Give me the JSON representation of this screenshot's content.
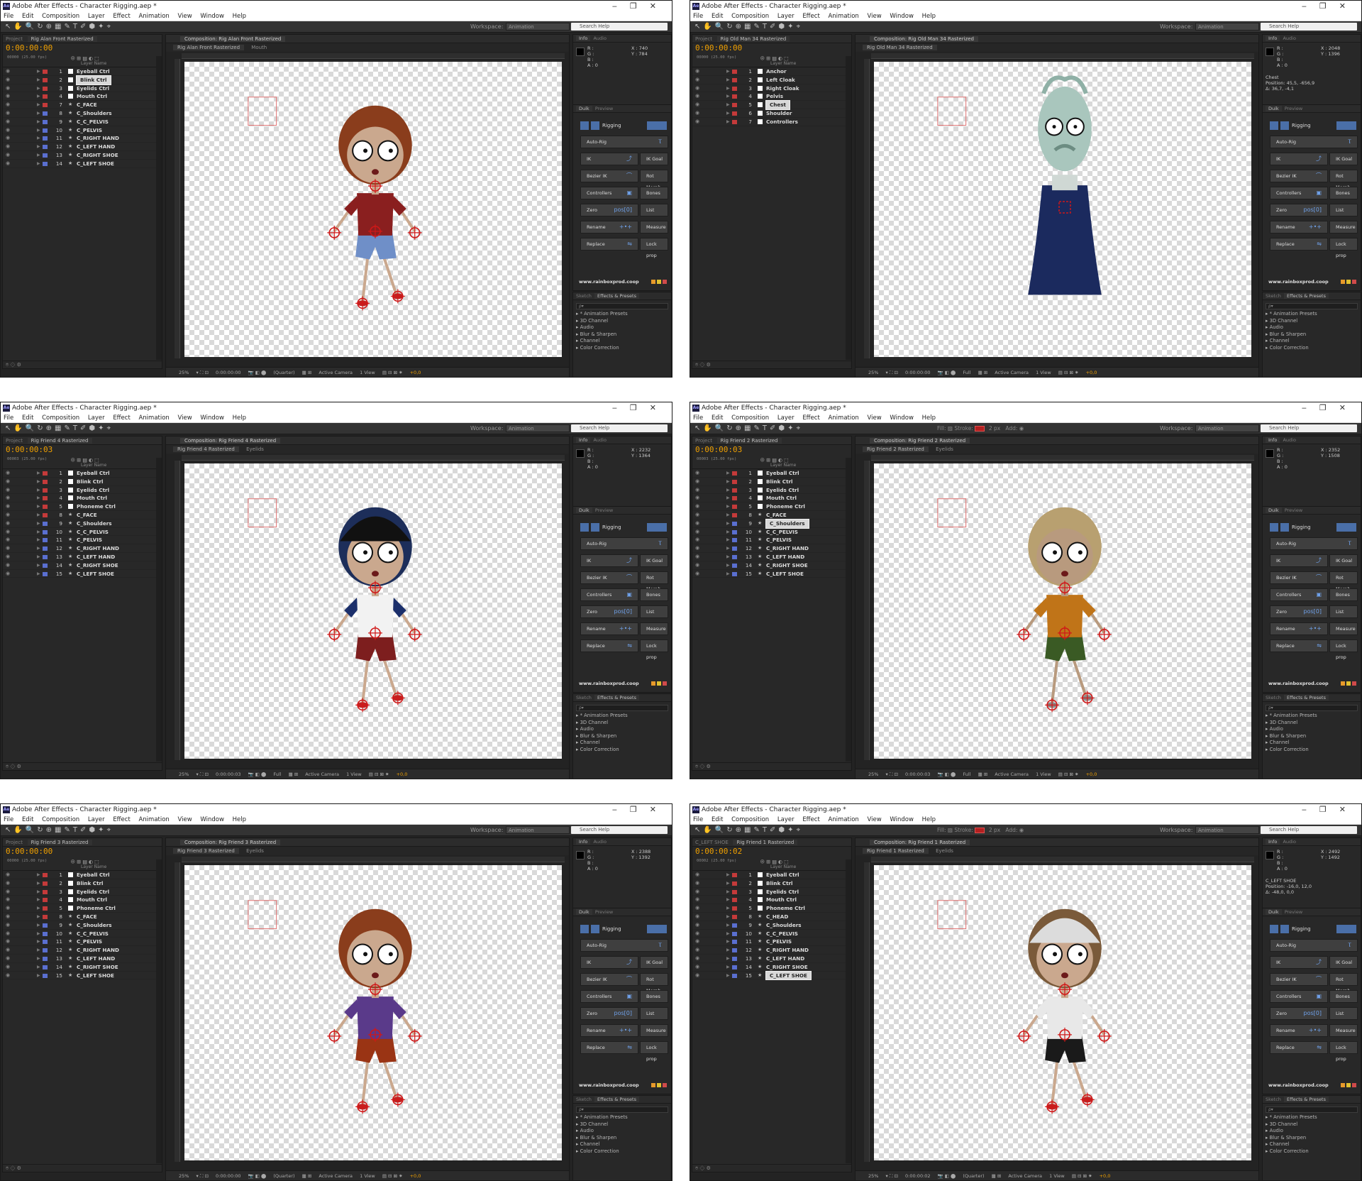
{
  "app": {
    "window_title": "Adobe After Effects - Character Rigging.aep *",
    "logo": "Ae",
    "window_controls": [
      "‒",
      "❐",
      "✕"
    ],
    "menu": [
      "File",
      "Edit",
      "Composition",
      "Layer",
      "Effect",
      "Animation",
      "View",
      "Window",
      "Help"
    ],
    "workspace_label": "Workspace:",
    "workspace_value": "Animation",
    "search_placeholder": "Search Help",
    "fill_label": "Fill:",
    "stroke_label": "Stroke:",
    "stroke_width": "2 px",
    "add_label": "Add:",
    "project_tab": "Project",
    "layer_name_header": "Layer Name",
    "info_tab": "Info",
    "audio_tab": "Audio",
    "duik_tab": "Duik",
    "preview_tab": "Preview",
    "sketch_tab": "Sketch",
    "effects_tab": "Effects & Presets",
    "rgb_lines": [
      "R :",
      "G :",
      "B :",
      "A : 0"
    ],
    "duik": {
      "rigging": "Rigging",
      "buttons": [
        {
          "label": "Auto-Rig",
          "icon": "Ⲧ"
        },
        {
          "label": "IK",
          "icon": "⤴"
        },
        {
          "label": "IK Goal",
          "icon": ""
        },
        {
          "label": "Bezier IK",
          "icon": "⌒"
        },
        {
          "label": "Rot Morph",
          "icon": ""
        },
        {
          "label": "Controllers",
          "icon": "▣"
        },
        {
          "label": "Bones",
          "icon": ""
        },
        {
          "label": "Zero",
          "icon": "pos[0]"
        },
        {
          "label": "List",
          "icon": ""
        },
        {
          "label": "Rename",
          "icon": "+•+"
        },
        {
          "label": "Measure",
          "icon": ""
        },
        {
          "label": "Replace",
          "icon": "⇋"
        },
        {
          "label": "Lock prop",
          "icon": ""
        }
      ],
      "site": "www.rainboxprod.coop",
      "colors": [
        "#e89a2a",
        "#e0c030",
        "#d04a4a"
      ]
    },
    "effects_search": "ρ▾",
    "effects_list": [
      "▸ * Animation Presets",
      "▸ 3D Channel",
      "▸ Audio",
      "▸ Blur & Sharpen",
      "▸ Channel",
      "▸ Color Correction"
    ],
    "footer": {
      "zoom": "25%",
      "camera": "Active Camera",
      "view": "1 View",
      "offset": "+0,0"
    }
  },
  "windows": [
    {
      "comp_tab": "Composition: Rig Alan Front Rasterized",
      "timeline_tab": "Rig Alan Front Rasterized",
      "sub_tab_a": "Rig Alan Front Rasterized",
      "sub_tab_b": "Mouth",
      "timecode": "0:00:00:00",
      "fps": "00000 (25.00 fps)",
      "x": "X : 740",
      "y": "Y : 784",
      "selection": [],
      "show_fill": false,
      "resolution": "(Quarter)",
      "footer_time": "0:00:00:00",
      "layers": [
        {
          "n": "1",
          "name": "Eyeball Ctrl",
          "color": "#c43a3a",
          "kind": "solid",
          "sel": false
        },
        {
          "n": "2",
          "name": "Blink Ctrl",
          "color": "#c43a3a",
          "kind": "solid",
          "sel": true
        },
        {
          "n": "3",
          "name": "Eyelids Ctrl",
          "color": "#c43a3a",
          "kind": "solid",
          "sel": false
        },
        {
          "n": "4",
          "name": "Mouth Ctrl",
          "color": "#c43a3a",
          "kind": "solid",
          "sel": false
        },
        {
          "n": "7",
          "name": "C_FACE",
          "color": "#c43a3a",
          "kind": "shape",
          "sel": false
        },
        {
          "n": "8",
          "name": "C_Shoulders",
          "color": "#5a6fd0",
          "kind": "shape",
          "sel": false
        },
        {
          "n": "9",
          "name": "C_C_PELVIS",
          "color": "#5a6fd0",
          "kind": "shape",
          "sel": false
        },
        {
          "n": "10",
          "name": "C_PELVIS",
          "color": "#5a6fd0",
          "kind": "shape",
          "sel": false
        },
        {
          "n": "11",
          "name": "C_RIGHT HAND",
          "color": "#5a6fd0",
          "kind": "shape",
          "sel": false
        },
        {
          "n": "12",
          "name": "C_LEFT HAND",
          "color": "#5a6fd0",
          "kind": "shape",
          "sel": false
        },
        {
          "n": "13",
          "name": "C_RIGHT SHOE",
          "color": "#5a6fd0",
          "kind": "shape",
          "sel": false
        },
        {
          "n": "14",
          "name": "C_LEFT SHOE",
          "color": "#5a6fd0",
          "kind": "shape",
          "sel": false
        }
      ]
    },
    {
      "comp_tab": "Composition: Rig Old Man 34 Rasterized",
      "timeline_tab": "Rig Old Man 34 Rasterized",
      "sub_tab_a": "Rig Old Man 34 Rasterized",
      "sub_tab_b": "",
      "timecode": "0:00:00:00",
      "fps": "00000 (25.00 fps)",
      "x": "X : 2048",
      "y": "Y : 1396",
      "selection": [
        "Chest",
        "Position: 45,5, -656,9",
        "Δ: 36,7, -4,1"
      ],
      "show_fill": false,
      "resolution": "Full",
      "footer_time": "0:00:00:00",
      "layers": [
        {
          "n": "1",
          "name": "Anchor",
          "color": "#c43a3a",
          "kind": "solid",
          "sel": false
        },
        {
          "n": "2",
          "name": "Left Cloak",
          "color": "#c43a3a",
          "kind": "solid",
          "sel": false
        },
        {
          "n": "3",
          "name": "Right Cloak",
          "color": "#c43a3a",
          "kind": "solid",
          "sel": false
        },
        {
          "n": "4",
          "name": "Pelvis",
          "color": "#c43a3a",
          "kind": "solid",
          "sel": false
        },
        {
          "n": "5",
          "name": "Chest",
          "color": "#c43a3a",
          "kind": "solid",
          "sel": true
        },
        {
          "n": "6",
          "name": "Shoulder",
          "color": "#c43a3a",
          "kind": "solid",
          "sel": false
        },
        {
          "n": "7",
          "name": "Controllers",
          "color": "#c43a3a",
          "kind": "solid",
          "sel": false
        }
      ]
    },
    {
      "comp_tab": "Composition: Rig Friend 4 Rasterized",
      "timeline_tab": "Rig Friend 4 Rasterized",
      "sub_tab_a": "Rig Friend 4 Rasterized",
      "sub_tab_b": "Eyelids",
      "timecode": "0:00:00:03",
      "fps": "00003 (25.00 fps)",
      "x": "X : 2232",
      "y": "Y : 1364",
      "selection": [],
      "show_fill": false,
      "resolution": "Full",
      "footer_time": "0:00:00:03",
      "layers": [
        {
          "n": "1",
          "name": "Eyeball Ctrl",
          "color": "#c43a3a",
          "kind": "solid",
          "sel": false
        },
        {
          "n": "2",
          "name": "Blink Ctrl",
          "color": "#c43a3a",
          "kind": "solid",
          "sel": false
        },
        {
          "n": "3",
          "name": "Eyelids Ctrl",
          "color": "#c43a3a",
          "kind": "solid",
          "sel": false
        },
        {
          "n": "4",
          "name": "Mouth Ctrl",
          "color": "#c43a3a",
          "kind": "solid",
          "sel": false
        },
        {
          "n": "5",
          "name": "Phoneme Ctrl",
          "color": "#c43a3a",
          "kind": "solid",
          "sel": false
        },
        {
          "n": "8",
          "name": "C_FACE",
          "color": "#c43a3a",
          "kind": "shape",
          "sel": false
        },
        {
          "n": "9",
          "name": "C_Shoulders",
          "color": "#5a6fd0",
          "kind": "shape",
          "sel": false
        },
        {
          "n": "10",
          "name": "C_C_PELVIS",
          "color": "#5a6fd0",
          "kind": "shape",
          "sel": false
        },
        {
          "n": "11",
          "name": "C_PELVIS",
          "color": "#5a6fd0",
          "kind": "shape",
          "sel": false
        },
        {
          "n": "12",
          "name": "C_RIGHT HAND",
          "color": "#5a6fd0",
          "kind": "shape",
          "sel": false
        },
        {
          "n": "13",
          "name": "C_LEFT HAND",
          "color": "#5a6fd0",
          "kind": "shape",
          "sel": false
        },
        {
          "n": "14",
          "name": "C_RIGHT SHOE",
          "color": "#5a6fd0",
          "kind": "shape",
          "sel": false
        },
        {
          "n": "15",
          "name": "C_LEFT SHOE",
          "color": "#5a6fd0",
          "kind": "shape",
          "sel": false
        }
      ]
    },
    {
      "comp_tab": "Composition: Rig Friend 2 Rasterized",
      "timeline_tab": "Rig Friend 2 Rasterized",
      "sub_tab_a": "Rig Friend 2 Rasterized",
      "sub_tab_b": "Eyelids",
      "timecode": "0:00:00:03",
      "fps": "00003 (25.00 fps)",
      "x": "X : 2352",
      "y": "Y : 1508",
      "selection": [],
      "show_fill": true,
      "resolution": "Full",
      "footer_time": "0:00:00:03",
      "layers": [
        {
          "n": "1",
          "name": "Eyeball Ctrl",
          "color": "#c43a3a",
          "kind": "solid",
          "sel": false
        },
        {
          "n": "2",
          "name": "Blink Ctrl",
          "color": "#c43a3a",
          "kind": "solid",
          "sel": false
        },
        {
          "n": "3",
          "name": "Eyelids Ctrl",
          "color": "#c43a3a",
          "kind": "solid",
          "sel": false
        },
        {
          "n": "4",
          "name": "Mouth Ctrl",
          "color": "#c43a3a",
          "kind": "solid",
          "sel": false
        },
        {
          "n": "5",
          "name": "Phoneme Ctrl",
          "color": "#c43a3a",
          "kind": "solid",
          "sel": false
        },
        {
          "n": "8",
          "name": "C_FACE",
          "color": "#c43a3a",
          "kind": "shape",
          "sel": false
        },
        {
          "n": "9",
          "name": "C_Shoulders",
          "color": "#5a6fd0",
          "kind": "shape",
          "sel": true
        },
        {
          "n": "10",
          "name": "C_C_PELVIS",
          "color": "#5a6fd0",
          "kind": "shape",
          "sel": false
        },
        {
          "n": "11",
          "name": "C_PELVIS",
          "color": "#5a6fd0",
          "kind": "shape",
          "sel": false
        },
        {
          "n": "12",
          "name": "C_RIGHT HAND",
          "color": "#5a6fd0",
          "kind": "shape",
          "sel": false
        },
        {
          "n": "13",
          "name": "C_LEFT HAND",
          "color": "#5a6fd0",
          "kind": "shape",
          "sel": false
        },
        {
          "n": "14",
          "name": "C_RIGHT SHOE",
          "color": "#5a6fd0",
          "kind": "shape",
          "sel": false
        },
        {
          "n": "15",
          "name": "C_LEFT SHOE",
          "color": "#5a6fd0",
          "kind": "shape",
          "sel": false
        }
      ]
    },
    {
      "comp_tab": "Composition: Rig Friend 3 Rasterized",
      "timeline_tab": "Rig Friend 3 Rasterized",
      "sub_tab_a": "Rig Friend 3 Rasterized",
      "sub_tab_b": "Eyelids",
      "timecode": "0:00:00:00",
      "fps": "00000 (25.00 fps)",
      "x": "X : 2388",
      "y": "Y : 1392",
      "selection": [],
      "show_fill": false,
      "resolution": "(Quarter)",
      "footer_time": "0:00:00:00",
      "layers": [
        {
          "n": "1",
          "name": "Eyeball Ctrl",
          "color": "#c43a3a",
          "kind": "solid",
          "sel": false
        },
        {
          "n": "2",
          "name": "Blink Ctrl",
          "color": "#c43a3a",
          "kind": "solid",
          "sel": false
        },
        {
          "n": "3",
          "name": "Eyelids Ctrl",
          "color": "#c43a3a",
          "kind": "solid",
          "sel": false
        },
        {
          "n": "4",
          "name": "Mouth Ctrl",
          "color": "#c43a3a",
          "kind": "solid",
          "sel": false
        },
        {
          "n": "5",
          "name": "Phoneme Ctrl",
          "color": "#c43a3a",
          "kind": "solid",
          "sel": false
        },
        {
          "n": "8",
          "name": "C_FACE",
          "color": "#c43a3a",
          "kind": "shape",
          "sel": false
        },
        {
          "n": "9",
          "name": "C_Shoulders",
          "color": "#5a6fd0",
          "kind": "shape",
          "sel": false
        },
        {
          "n": "10",
          "name": "C_C_PELVIS",
          "color": "#5a6fd0",
          "kind": "shape",
          "sel": false
        },
        {
          "n": "11",
          "name": "C_PELVIS",
          "color": "#5a6fd0",
          "kind": "shape",
          "sel": false
        },
        {
          "n": "12",
          "name": "C_RIGHT HAND",
          "color": "#5a6fd0",
          "kind": "shape",
          "sel": false
        },
        {
          "n": "13",
          "name": "C_LEFT HAND",
          "color": "#5a6fd0",
          "kind": "shape",
          "sel": false
        },
        {
          "n": "14",
          "name": "C_RIGHT SHOE",
          "color": "#5a6fd0",
          "kind": "shape",
          "sel": false
        },
        {
          "n": "15",
          "name": "C_LEFT SHOE",
          "color": "#5a6fd0",
          "kind": "shape",
          "sel": false
        }
      ]
    },
    {
      "comp_tab": "Composition: Rig Friend 1 Rasterized",
      "timeline_tab": "Rig Friend 1 Rasterized",
      "sub_tab_a": "Rig Friend 1 Rasterized",
      "sub_tab_b": "Eyelids",
      "timecode": "0:00:00:02",
      "fps": "00002 (25.00 fps)",
      "x": "X : 2492",
      "y": "Y : 1492",
      "selection": [
        "C_LEFT SHOE",
        "Position: -16,0, 12,0",
        "Δ: -48,0, 0,0"
      ],
      "show_fill": true,
      "resolution": "(Quarter)",
      "footer_time": "0:00:00:02",
      "project_label": "C_LEFT SHOE",
      "layers": [
        {
          "n": "1",
          "name": "Eyeball Ctrl",
          "color": "#c43a3a",
          "kind": "solid",
          "sel": false
        },
        {
          "n": "2",
          "name": "Blink Ctrl",
          "color": "#c43a3a",
          "kind": "solid",
          "sel": false
        },
        {
          "n": "3",
          "name": "Eyelids Ctrl",
          "color": "#c43a3a",
          "kind": "solid",
          "sel": false
        },
        {
          "n": "4",
          "name": "Mouth Ctrl",
          "color": "#c43a3a",
          "kind": "solid",
          "sel": false
        },
        {
          "n": "5",
          "name": "Phoneme Ctrl",
          "color": "#c43a3a",
          "kind": "solid",
          "sel": false
        },
        {
          "n": "8",
          "name": "C_HEAD",
          "color": "#c43a3a",
          "kind": "shape",
          "sel": false
        },
        {
          "n": "9",
          "name": "C_Shoulders",
          "color": "#5a6fd0",
          "kind": "shape",
          "sel": false
        },
        {
          "n": "10",
          "name": "C_C_PELVIS",
          "color": "#5a6fd0",
          "kind": "shape",
          "sel": false
        },
        {
          "n": "11",
          "name": "C_PELVIS",
          "color": "#5a6fd0",
          "kind": "shape",
          "sel": false
        },
        {
          "n": "12",
          "name": "C_RIGHT HAND",
          "color": "#5a6fd0",
          "kind": "shape",
          "sel": false
        },
        {
          "n": "13",
          "name": "C_LEFT HAND",
          "color": "#5a6fd0",
          "kind": "shape",
          "sel": false
        },
        {
          "n": "14",
          "name": "C_RIGHT SHOE",
          "color": "#5a6fd0",
          "kind": "shape",
          "sel": false
        },
        {
          "n": "15",
          "name": "C_LEFT SHOE",
          "color": "#5a6fd0",
          "kind": "shape",
          "sel": true
        }
      ]
    }
  ],
  "characters": [
    {
      "hair": "#8a3d1c",
      "hat": "",
      "shirt": "#8a1f1f",
      "sleeve": "#8a1f1f",
      "pants": "#6f8fc8",
      "skin": "#caa88e",
      "shoe": "#c42020"
    },
    {
      "hair": "",
      "hat": "",
      "shirt": "#1b2a5e",
      "sleeve": "#1b2a5e",
      "pants": "#1b2a5e",
      "skin": "#a9c6bd",
      "shoe": "#1b2a5e"
    },
    {
      "hair": "#1d2e5a",
      "hat": "#111111",
      "shirt": "#f2f2f2",
      "sleeve": "#1b2f6b",
      "pants": "#7d1e1e",
      "skin": "#caa88e",
      "shoe": "#c42020"
    },
    {
      "hair": "#b8a070",
      "hat": "",
      "shirt": "#c07418",
      "sleeve": "#c07418",
      "pants": "#3a5a24",
      "skin": "#b89a7e",
      "shoe": "#8a8a8a"
    },
    {
      "hair": "#8a3d1c",
      "hat": "",
      "shirt": "#5a3a8a",
      "sleeve": "#5a3a8a",
      "pants": "#9a3414",
      "skin": "#caa88e",
      "shoe": "#c42020"
    },
    {
      "hair": "#7a5a3a",
      "hat": "#dcdcdc",
      "shirt": "#e8e8e8",
      "sleeve": "#e8e8e8",
      "pants": "#1a1a1a",
      "skin": "#caa88e",
      "shoe": "#c42020"
    }
  ]
}
